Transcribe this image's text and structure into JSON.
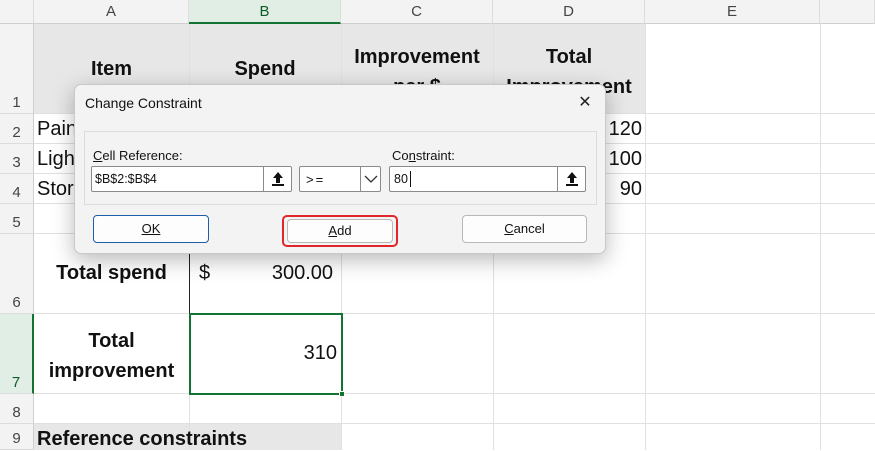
{
  "columns": [
    "A",
    "B",
    "C",
    "D",
    "E"
  ],
  "rows": [
    "1",
    "2",
    "3",
    "4",
    "5",
    "6",
    "7",
    "8",
    "9"
  ],
  "cells": {
    "a1": "Item",
    "b1": "Spend",
    "c1": "Improvement per $",
    "d1": "Total Improvement",
    "a2": "Pain",
    "a3": "Ligh",
    "a4": "Stor",
    "d2": "120",
    "d3": "100",
    "d4": "90",
    "a6": "Total spend",
    "b6_currency": "$",
    "b6_value": "300.00",
    "a7": "Total improvement",
    "b7": "310",
    "a9": "Reference constraints"
  },
  "dialog": {
    "title": "Change Constraint",
    "close_glyph": "✕",
    "cell_ref_label_accel": "C",
    "cell_ref_label_rest": "ell Reference:",
    "cell_ref_value": "$B$2:$B$4",
    "operator_value": ">=",
    "constraint_label_pre": "Co",
    "constraint_label_accel": "n",
    "constraint_label_rest": "straint:",
    "constraint_value": "80",
    "ok_label": "OK",
    "add_label_accel": "A",
    "add_label_rest": "dd",
    "cancel_label_accel": "C",
    "cancel_label_rest": "ancel"
  },
  "colors": {
    "selection_green": "#137333",
    "highlight_red": "#e0262a"
  }
}
